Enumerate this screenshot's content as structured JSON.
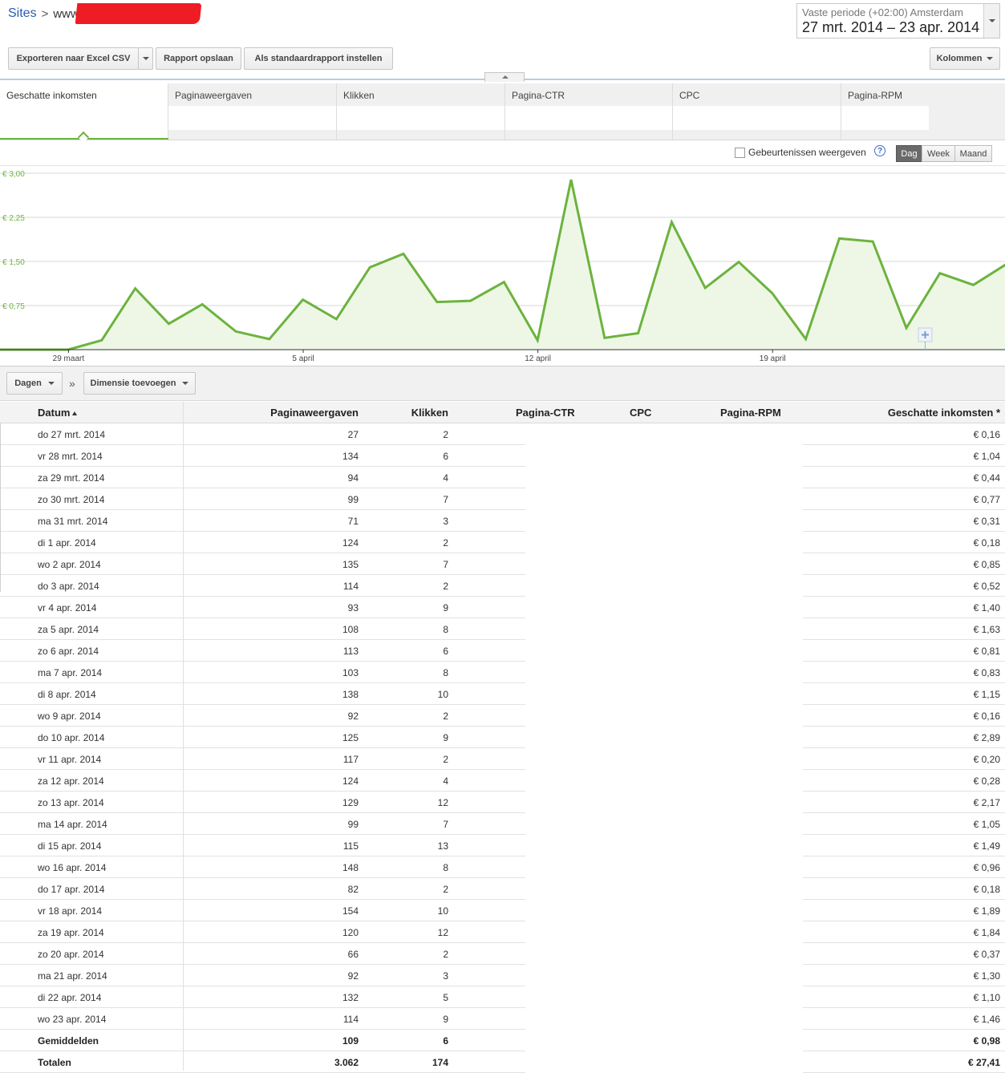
{
  "breadcrumb": {
    "root": "Sites",
    "separator": ">",
    "site": "www"
  },
  "date_picker": {
    "label": "Vaste periode (+02:00) Amsterdam",
    "range": "27 mrt. 2014 – 23 apr. 2014"
  },
  "toolbar": {
    "export": "Exporteren naar Excel CSV",
    "save_report": "Rapport opslaan",
    "set_default": "Als standaardrapport instellen",
    "columns": "Kolommen"
  },
  "metric_tabs": [
    "Geschatte inkomsten",
    "Paginaweergaven",
    "Klikken",
    "Pagina-CTR",
    "CPC",
    "Pagina-RPM"
  ],
  "chart_toolbar": {
    "events_label": "Gebeurtenissen weergeven",
    "help": "?",
    "periods": [
      "Dag",
      "Week",
      "Maand"
    ],
    "active_period": "Dag"
  },
  "chart_data": {
    "type": "area",
    "x": [
      "27 mrt.",
      "28 mrt.",
      "29 mrt.",
      "30 mrt.",
      "31 mrt.",
      "1 apr.",
      "2 apr.",
      "3 apr.",
      "4 apr.",
      "5 apr.",
      "6 apr.",
      "7 apr.",
      "8 apr.",
      "9 apr.",
      "10 apr.",
      "11 apr.",
      "12 apr.",
      "13 apr.",
      "14 apr.",
      "15 apr.",
      "16 apr.",
      "17 apr.",
      "18 apr.",
      "19 apr.",
      "20 apr.",
      "21 apr.",
      "22 apr.",
      "23 apr."
    ],
    "series": [
      {
        "values": [
          0.16,
          1.04,
          0.44,
          0.77,
          0.31,
          0.18,
          0.85,
          0.52,
          1.4,
          1.63,
          0.81,
          0.83,
          1.15,
          0.16,
          2.89,
          0.2,
          0.28,
          2.17,
          1.05,
          1.49,
          0.96,
          0.18,
          1.89,
          1.84,
          0.37,
          1.3,
          1.1,
          1.46
        ]
      }
    ],
    "ylim": [
      0,
      3.0
    ],
    "y_ticks": [
      "€ 3,00",
      "€ 2,25",
      "€ 1,50",
      "€ 0,75"
    ],
    "x_tick_labels": [
      "29 maart",
      "5 april",
      "12 april",
      "19 april"
    ],
    "x_tick_index": [
      2,
      9,
      16,
      23
    ],
    "grid": true,
    "color": "#6cb33e",
    "fill": "#eef7e6"
  },
  "dimensions": {
    "group": "Dagen",
    "chevron": "»",
    "add": "Dimensie toevoegen"
  },
  "table": {
    "headers": {
      "date": "Datum",
      "pageviews": "Paginaweergaven",
      "clicks": "Klikken",
      "ctr": "Pagina-CTR",
      "cpc": "CPC",
      "rpm": "Pagina-RPM",
      "earnings": "Geschatte inkomsten *"
    },
    "rows": [
      {
        "date": "do 27 mrt. 2014",
        "pv": "27",
        "clicks": "2",
        "earn": "€ 0,16"
      },
      {
        "date": "vr 28 mrt. 2014",
        "pv": "134",
        "clicks": "6",
        "earn": "€ 1,04"
      },
      {
        "date": "za 29 mrt. 2014",
        "pv": "94",
        "clicks": "4",
        "earn": "€ 0,44"
      },
      {
        "date": "zo 30 mrt. 2014",
        "pv": "99",
        "clicks": "7",
        "earn": "€ 0,77"
      },
      {
        "date": "ma 31 mrt. 2014",
        "pv": "71",
        "clicks": "3",
        "earn": "€ 0,31"
      },
      {
        "date": "di 1 apr. 2014",
        "pv": "124",
        "clicks": "2",
        "earn": "€ 0,18"
      },
      {
        "date": "wo 2 apr. 2014",
        "pv": "135",
        "clicks": "7",
        "earn": "€ 0,85"
      },
      {
        "date": "do 3 apr. 2014",
        "pv": "114",
        "clicks": "2",
        "earn": "€ 0,52"
      },
      {
        "date": "vr 4 apr. 2014",
        "pv": "93",
        "clicks": "9",
        "earn": "€ 1,40"
      },
      {
        "date": "za 5 apr. 2014",
        "pv": "108",
        "clicks": "8",
        "earn": "€ 1,63"
      },
      {
        "date": "zo 6 apr. 2014",
        "pv": "113",
        "clicks": "6",
        "earn": "€ 0,81"
      },
      {
        "date": "ma 7 apr. 2014",
        "pv": "103",
        "clicks": "8",
        "earn": "€ 0,83"
      },
      {
        "date": "di 8 apr. 2014",
        "pv": "138",
        "clicks": "10",
        "earn": "€ 1,15"
      },
      {
        "date": "wo 9 apr. 2014",
        "pv": "92",
        "clicks": "2",
        "earn": "€ 0,16"
      },
      {
        "date": "do 10 apr. 2014",
        "pv": "125",
        "clicks": "9",
        "earn": "€ 2,89"
      },
      {
        "date": "vr 11 apr. 2014",
        "pv": "117",
        "clicks": "2",
        "earn": "€ 0,20"
      },
      {
        "date": "za 12 apr. 2014",
        "pv": "124",
        "clicks": "4",
        "earn": "€ 0,28"
      },
      {
        "date": "zo 13 apr. 2014",
        "pv": "129",
        "clicks": "12",
        "earn": "€ 2,17"
      },
      {
        "date": "ma 14 apr. 2014",
        "pv": "99",
        "clicks": "7",
        "earn": "€ 1,05"
      },
      {
        "date": "di 15 apr. 2014",
        "pv": "115",
        "clicks": "13",
        "earn": "€ 1,49"
      },
      {
        "date": "wo 16 apr. 2014",
        "pv": "148",
        "clicks": "8",
        "earn": "€ 0,96"
      },
      {
        "date": "do 17 apr. 2014",
        "pv": "82",
        "clicks": "2",
        "earn": "€ 0,18"
      },
      {
        "date": "vr 18 apr. 2014",
        "pv": "154",
        "clicks": "10",
        "earn": "€ 1,89"
      },
      {
        "date": "za 19 apr. 2014",
        "pv": "120",
        "clicks": "12",
        "earn": "€ 1,84"
      },
      {
        "date": "zo 20 apr. 2014",
        "pv": "66",
        "clicks": "2",
        "earn": "€ 0,37"
      },
      {
        "date": "ma 21 apr. 2014",
        "pv": "92",
        "clicks": "3",
        "earn": "€ 1,30"
      },
      {
        "date": "di 22 apr. 2014",
        "pv": "132",
        "clicks": "5",
        "earn": "€ 1,10"
      },
      {
        "date": "wo 23 apr. 2014",
        "pv": "114",
        "clicks": "9",
        "earn": "€ 1,46"
      }
    ],
    "averages": {
      "label": "Gemiddelden",
      "pv": "109",
      "clicks": "6",
      "earn": "€ 0,98"
    },
    "totals": {
      "label": "Totalen",
      "pv": "3.062",
      "clicks": "174",
      "earn": "€ 27,41"
    }
  }
}
